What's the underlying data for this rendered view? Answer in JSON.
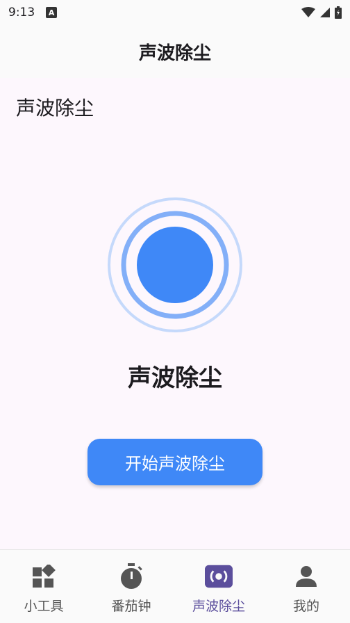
{
  "status_bar": {
    "time": "9:13",
    "a_glyph": "A"
  },
  "app_bar": {
    "title": "声波除尘"
  },
  "main": {
    "heading": "声波除尘",
    "center_title": "声波除尘",
    "start_button_label": "开始声波除尘",
    "pulse_icon": "sound-pulse-icon"
  },
  "bottom_nav": {
    "items": [
      {
        "label": "小工具",
        "icon": "widgets-icon"
      },
      {
        "label": "番茄钟",
        "icon": "timer-icon"
      },
      {
        "label": "声波除尘",
        "icon": "sound-wave-icon",
        "active": true
      },
      {
        "label": "我的",
        "icon": "person-icon"
      }
    ]
  },
  "colors": {
    "accent_blue": "#3f88f7",
    "active_nav": "#5b4e9c",
    "page_background": "#fdf7fd"
  }
}
